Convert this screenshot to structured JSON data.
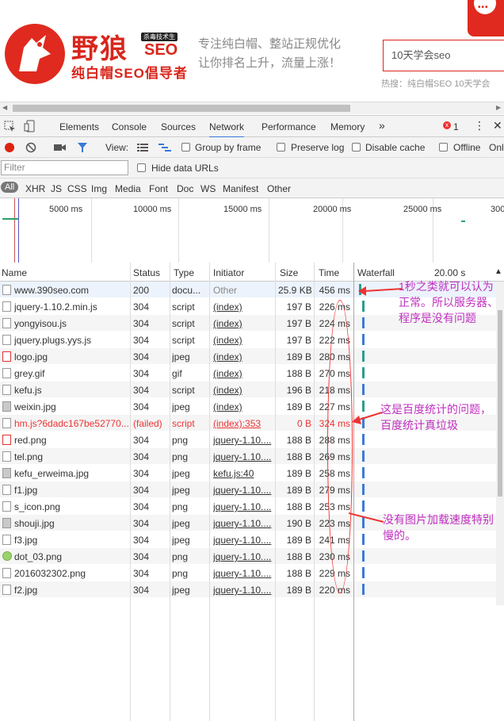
{
  "site": {
    "brand": "野狼",
    "brand_seo": "SEO",
    "brand_tag": "杀毒技术生",
    "brand_sub": "纯白帽SEO倡导者",
    "slogan_line1": "专注纯白帽、整站正规优化",
    "slogan_line2": "让你排名上升，流量上涨！",
    "search_value": "10天学会seo",
    "hot": "热搜：纯白帽SEO 10天学会",
    "chat_icon": "chat-bubble-icon"
  },
  "devtools": {
    "tabs": [
      "Elements",
      "Console",
      "Sources",
      "Network",
      "Performance",
      "Memory"
    ],
    "active_tab": "Network",
    "more": "»",
    "error_count": "1",
    "toolbar": {
      "view_label": "View:",
      "group_by_frame": "Group by frame",
      "preserve_log": "Preserve log",
      "disable_cache": "Disable cache",
      "offline": "Offline",
      "online": "Onl"
    },
    "filter_placeholder": "Filter",
    "hide_data_urls": "Hide data URLs",
    "types": [
      "All",
      "XHR",
      "JS",
      "CSS",
      "Img",
      "Media",
      "Font",
      "Doc",
      "WS",
      "Manifest",
      "Other"
    ],
    "overview_ticks": [
      "5000 ms",
      "10000 ms",
      "15000 ms",
      "20000 ms",
      "25000 ms",
      "300"
    ],
    "columns": {
      "name": "Name",
      "status": "Status",
      "type": "Type",
      "initiator": "Initiator",
      "size": "Size",
      "time": "Time",
      "waterfall": "Waterfall",
      "waterfall_scale": "20.00 s"
    },
    "rows": [
      {
        "name": "www.390seo.com",
        "status": "200",
        "type": "docu...",
        "initiator": "Other",
        "size": "25.9 KB",
        "time": "456 ms",
        "icon": "doc"
      },
      {
        "name": "jquery-1.10.2.min.js",
        "status": "304",
        "type": "script",
        "initiator": "(index)",
        "size": "197 B",
        "time": "226 ms",
        "icon": "doc"
      },
      {
        "name": "yongyisou.js",
        "status": "304",
        "type": "script",
        "initiator": "(index)",
        "size": "197 B",
        "time": "224 ms",
        "icon": "doc"
      },
      {
        "name": "jquery.plugs.yys.js",
        "status": "304",
        "type": "script",
        "initiator": "(index)",
        "size": "197 B",
        "time": "222 ms",
        "icon": "doc"
      },
      {
        "name": "logo.jpg",
        "status": "304",
        "type": "jpeg",
        "initiator": "(index)",
        "size": "189 B",
        "time": "280 ms",
        "icon": "red"
      },
      {
        "name": "grey.gif",
        "status": "304",
        "type": "gif",
        "initiator": "(index)",
        "size": "188 B",
        "time": "270 ms",
        "icon": "doc"
      },
      {
        "name": "kefu.js",
        "status": "304",
        "type": "script",
        "initiator": "(index)",
        "size": "196 B",
        "time": "218 ms",
        "icon": "doc"
      },
      {
        "name": "weixin.jpg",
        "status": "304",
        "type": "jpeg",
        "initiator": "(index)",
        "size": "189 B",
        "time": "227 ms",
        "icon": "img"
      },
      {
        "name": "hm.js?6dadc167be52770...",
        "status": "(failed)",
        "type": "script",
        "initiator": "(index):353",
        "size": "0 B",
        "time": "324 ms",
        "icon": "doc",
        "failed": true
      },
      {
        "name": "red.png",
        "status": "304",
        "type": "png",
        "initiator": "jquery-1.10....",
        "size": "188 B",
        "time": "288 ms",
        "icon": "red"
      },
      {
        "name": "tel.png",
        "status": "304",
        "type": "png",
        "initiator": "jquery-1.10....",
        "size": "188 B",
        "time": "269 ms",
        "icon": "doc"
      },
      {
        "name": "kefu_erweima.jpg",
        "status": "304",
        "type": "jpeg",
        "initiator": "kefu.js:40",
        "size": "189 B",
        "time": "258 ms",
        "icon": "img"
      },
      {
        "name": "f1.jpg",
        "status": "304",
        "type": "jpeg",
        "initiator": "jquery-1.10....",
        "size": "189 B",
        "time": "279 ms",
        "icon": "doc"
      },
      {
        "name": "s_icon.png",
        "status": "304",
        "type": "png",
        "initiator": "jquery-1.10....",
        "size": "188 B",
        "time": "253 ms",
        "icon": "doc"
      },
      {
        "name": "shouji.jpg",
        "status": "304",
        "type": "jpeg",
        "initiator": "jquery-1.10....",
        "size": "190 B",
        "time": "223 ms",
        "icon": "img"
      },
      {
        "name": "f3.jpg",
        "status": "304",
        "type": "jpeg",
        "initiator": "jquery-1.10....",
        "size": "189 B",
        "time": "241 ms",
        "icon": "doc"
      },
      {
        "name": "dot_03.png",
        "status": "304",
        "type": "png",
        "initiator": "jquery-1.10....",
        "size": "188 B",
        "time": "230 ms",
        "icon": "png"
      },
      {
        "name": "2016032302.png",
        "status": "304",
        "type": "png",
        "initiator": "jquery-1.10....",
        "size": "188 B",
        "time": "229 ms",
        "icon": "doc"
      },
      {
        "name": "f2.jpg",
        "status": "304",
        "type": "jpeg",
        "initiator": "jquery-1.10....",
        "size": "189 B",
        "time": "220 ms",
        "icon": "doc"
      }
    ]
  },
  "annotations": {
    "a1": "1秒之类就可以认为正常。所以服务器、程序是没有问题",
    "a2": "这是百度统计的问题，百度统计真垃圾",
    "a3": "没有图片加载速度特别慢的。"
  },
  "colors": {
    "brand_red": "#d9261c",
    "annotation": "#c030c0",
    "arrow": "#e33333",
    "active_tab": "#3879d9"
  }
}
